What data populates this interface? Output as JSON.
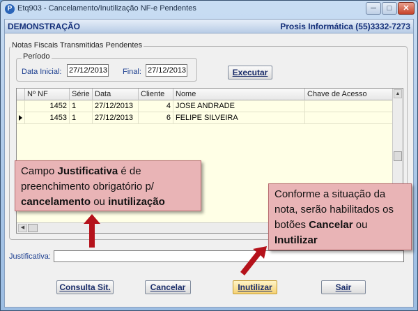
{
  "window": {
    "app_icon": "P",
    "title": "Etq903 - Cancelamento/Inutilização NF-e Pendentes",
    "min_label": "─",
    "max_label": "□",
    "close_label": "✕"
  },
  "header": {
    "company": "DEMONSTRAÇÃO",
    "vendor": "Prosis Informática (55)3332-7273"
  },
  "group_label": "Notas Fiscais Transmitidas Pendentes",
  "periodo": {
    "label": "Período",
    "data_inicial_label": "Data Inicial:",
    "data_inicial": "27/12/2013",
    "final_label": "Final:",
    "final": "27/12/2013"
  },
  "executar_label": "Executar",
  "grid": {
    "columns": [
      "Nº NF",
      "Série",
      "Data",
      "Cliente",
      "Nome",
      "Chave de Acesso"
    ],
    "rows": [
      {
        "nf": "1452",
        "serie": "1",
        "data": "27/12/2013",
        "cliente": "4",
        "nome": "JOSE ANDRADE",
        "chave": ""
      },
      {
        "nf": "1453",
        "serie": "1",
        "data": "27/12/2013",
        "cliente": "6",
        "nome": "FELIPE SILVEIRA",
        "chave": ""
      }
    ],
    "scroll_up_glyph": "▲",
    "scroll_left_glyph": "◀"
  },
  "justificativa_label": "Justificativa:",
  "justificativa_value": "",
  "buttons": {
    "consulta": "Consulta Sit.",
    "cancelar": "Cancelar",
    "inutilizar": "Inutilizar",
    "sair": "Sair"
  },
  "callouts": {
    "left": {
      "p1": "Campo ",
      "b1": "Justificativa",
      "p2": " é de preenchimento obrigatório p/ ",
      "b2": "cancelamento",
      "p3": " ou ",
      "b3": "inutilização"
    },
    "right": {
      "p1": "Conforme a situação da nota, serão habilitados os botões ",
      "b1": "Cancelar",
      "p2": " ou ",
      "b2": "Inutilizar"
    }
  },
  "colors": {
    "arrow": "#b5121b",
    "callout_bg": "#e9b4b6",
    "grid_bg": "#ffffe6"
  }
}
